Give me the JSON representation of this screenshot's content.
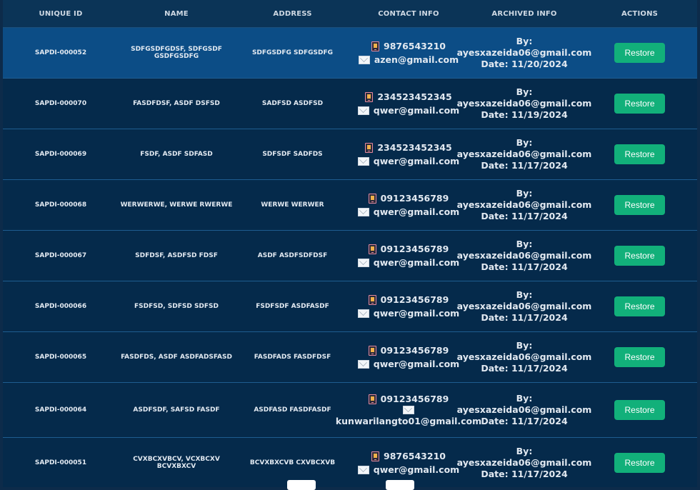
{
  "headers": [
    "UNIQUE ID",
    "NAME",
    "ADDRESS",
    "CONTACT INFO",
    "ARCHIVED INFO",
    "ACTIONS"
  ],
  "archived_prefix": "By:",
  "restore_label": "Restore",
  "rows": [
    {
      "id": "SAPDI-000052",
      "name": "SDFGSDFGDSF, SDFGSDF GSDFGSDFG",
      "address": "SDFGSDFG SDFGSDFG",
      "phone": "9876543210",
      "email": "azen@gmail.com",
      "by": "ayesxazeida06@gmail.com",
      "date": "Date: 11/20/2024"
    },
    {
      "id": "SAPDI-000070",
      "name": "FASDFDSF, ASDF DSFSD",
      "address": "SADFSD ASDFSD",
      "phone": "234523452345",
      "email": "qwer@gmail.com",
      "by": "ayesxazeida06@gmail.com",
      "date": "Date: 11/19/2024"
    },
    {
      "id": "SAPDI-000069",
      "name": "FSDF, ASDF SDFASD",
      "address": "SDFSDF SADFDS",
      "phone": "234523452345",
      "email": "qwer@gmail.com",
      "by": "ayesxazeida06@gmail.com",
      "date": "Date: 11/17/2024"
    },
    {
      "id": "SAPDI-000068",
      "name": "WERWERWE, WERWE RWERWE",
      "address": "WERWE WERWER",
      "phone": "09123456789",
      "email": "qwer@gmail.com",
      "by": "ayesxazeida06@gmail.com",
      "date": "Date: 11/17/2024"
    },
    {
      "id": "SAPDI-000067",
      "name": "SDFDSF, ASDFSD FDSF",
      "address": "ASDF ASDFSDFDSF",
      "phone": "09123456789",
      "email": "qwer@gmail.com",
      "by": "ayesxazeida06@gmail.com",
      "date": "Date: 11/17/2024"
    },
    {
      "id": "SAPDI-000066",
      "name": "FSDFSD, SDFSD SDFSD",
      "address": "FSDFSDF ASDFASDF",
      "phone": "09123456789",
      "email": "qwer@gmail.com",
      "by": "ayesxazeida06@gmail.com",
      "date": "Date: 11/17/2024"
    },
    {
      "id": "SAPDI-000065",
      "name": "FASDFDS, ASDF ASDFADSFASD",
      "address": "FASDFADS FASDFDSF",
      "phone": "09123456789",
      "email": "qwer@gmail.com",
      "by": "ayesxazeida06@gmail.com",
      "date": "Date: 11/17/2024"
    },
    {
      "id": "SAPDI-000064",
      "name": "ASDFSDF, SAFSD FASDF",
      "address": "ASDFASD FASDFASDF",
      "phone": "09123456789",
      "email": "kunwarilangto01@gmail.com",
      "by": "ayesxazeida06@gmail.com",
      "date": "Date: 11/17/2024"
    },
    {
      "id": "SAPDI-000051",
      "name": "CVXBCXVBCV, VCXBCXV BCVXBXCV",
      "address": "BCVXBXCVB CXVBCXVB",
      "phone": "9876543210",
      "email": "qwer@gmail.com",
      "by": "ayesxazeida06@gmail.com",
      "date": "Date: 11/17/2024"
    }
  ]
}
